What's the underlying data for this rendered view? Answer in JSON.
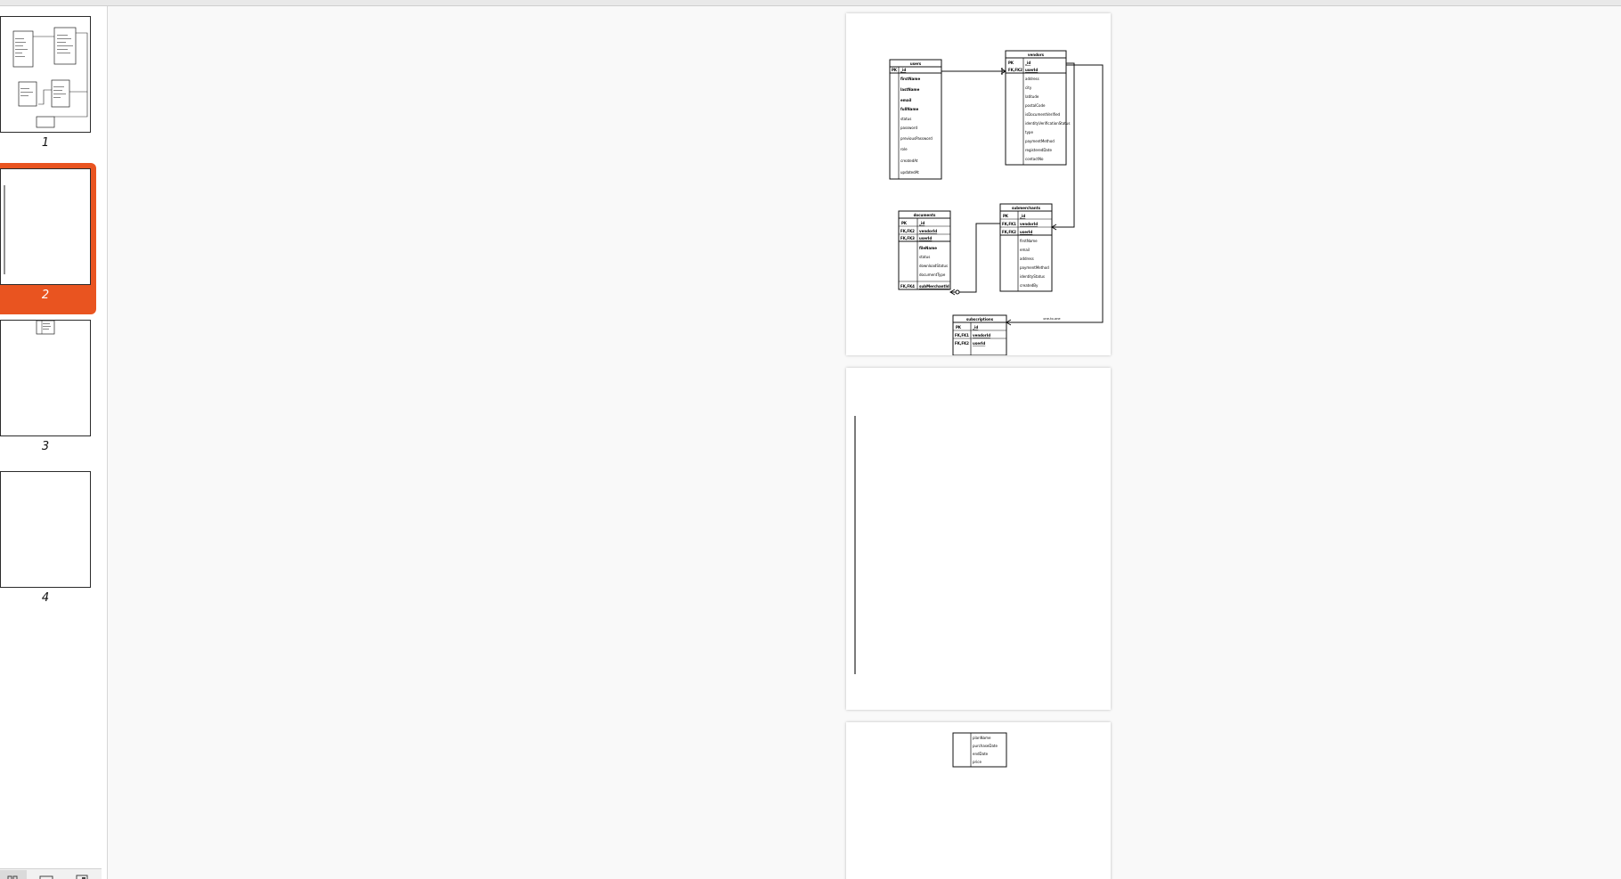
{
  "thumbnails": [
    {
      "label": "1"
    },
    {
      "label": "2"
    },
    {
      "label": "3"
    },
    {
      "label": "4"
    }
  ],
  "selected_page": "2",
  "toolbar": {
    "grid_icon": "grid-view-icon",
    "single_icon": "single-page-icon",
    "fit_icon": "fit-page-icon"
  },
  "colors": {
    "accent": "#e95420",
    "background": "#f9f9f9",
    "sidebar": "#ffffff"
  },
  "diagram": {
    "users": {
      "title": "users",
      "pk": "PK",
      "pk_field": "_id",
      "fields": [
        "firstName",
        "lastName",
        "email",
        "fullName",
        "status",
        "password",
        "previousPassword",
        "role",
        "createdAt",
        "updatedAt"
      ]
    },
    "vendors": {
      "title": "vendors",
      "keys": [
        "PK",
        "FK,FK2"
      ],
      "key_fields": [
        "_id",
        "userId"
      ],
      "fields": [
        "address",
        "city",
        "latitude",
        "postalCode",
        "isDocumentVerified",
        "identityVerificationStatus",
        "type",
        "paymentMethod",
        "registeredDate",
        "contactNo"
      ]
    },
    "documents": {
      "title": "documents",
      "keys": [
        "PK",
        "FK,FK2",
        "FK,FK3"
      ],
      "key_fields": [
        "_id",
        "vendorId",
        "userId"
      ],
      "fields": [
        "fileName",
        "status",
        "downloadStatus",
        "documentType"
      ],
      "fk_key": "FK,FK4",
      "fk_field": "subMerchantId"
    },
    "submerchants": {
      "title": "submerchants",
      "keys": [
        "PK",
        "FK,FK1",
        "FK,FK2"
      ],
      "key_fields": [
        "_id",
        "vendorId",
        "userId"
      ],
      "fields": [
        "firstName",
        "email",
        "address",
        "paymentMethod",
        "identityStatus",
        "createdBy"
      ]
    },
    "subscriptions": {
      "title": "subscriptions",
      "keys": [
        "PK",
        "FK,FK1",
        "FK,FK2"
      ],
      "key_fields": [
        "_id",
        "vendorId",
        "userId"
      ],
      "relation_label": "one-to-one"
    },
    "subscriptions_cont": {
      "fields": [
        "planName",
        "purchaseDate",
        "endDate",
        "price"
      ]
    }
  }
}
